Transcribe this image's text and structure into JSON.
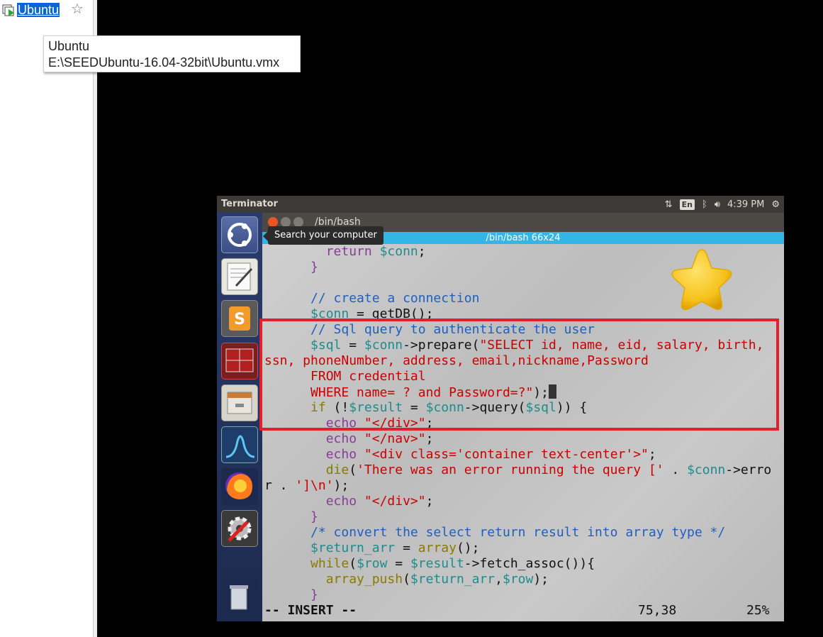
{
  "library": {
    "vm_name": "Ubuntu",
    "favorite_icon": "star-outline-icon"
  },
  "tooltip": {
    "line1": "Ubuntu",
    "line2": "E:\\SEEDUbuntu-16.04-32bit\\Ubuntu.vmx"
  },
  "ubuntu_topbar": {
    "app_title": "Terminator",
    "lang": "En",
    "time": "4:39 PM"
  },
  "launcher": {
    "search_tooltip": "Search your computer",
    "items": [
      "ubuntu-dash-icon",
      "text-editor-icon",
      "sublime-text-icon",
      "terminator-icon",
      "file-manager-icon",
      "wireshark-icon",
      "firefox-icon",
      "system-settings-icon",
      "trash-icon"
    ]
  },
  "terminal": {
    "window_title": "/bin/bash",
    "tab_label": "/bin/bash 66x24"
  },
  "vim": {
    "mode": "-- INSERT --",
    "position": "75,38",
    "percent": "25%"
  },
  "colors": {
    "annotation_box": "#e0202a",
    "tab_bar": "#33b5e5"
  }
}
